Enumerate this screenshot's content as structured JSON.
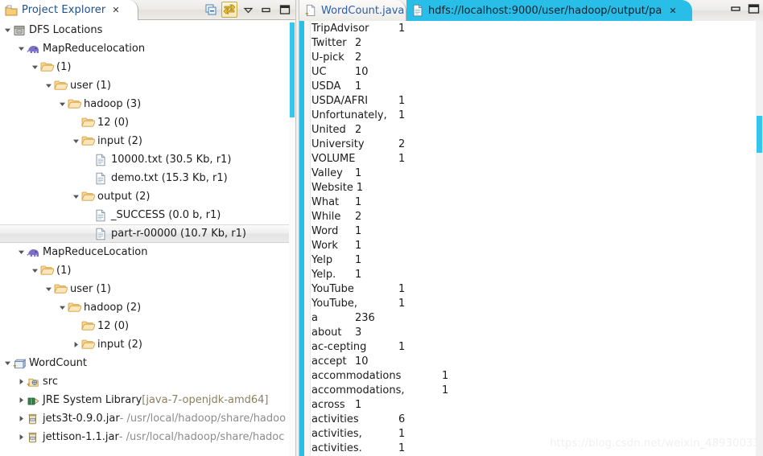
{
  "explorer": {
    "tab_title": "Project Explorer",
    "tab_close": "✕",
    "toolbar": [
      {
        "name": "collapse-all-icon",
        "title": "Collapse All"
      },
      {
        "name": "link-with-editor-icon",
        "title": "Link with Editor"
      },
      {
        "name": "view-menu-icon",
        "title": "View Menu"
      },
      {
        "name": "minimize-icon",
        "title": "Minimize"
      },
      {
        "name": "maximize-icon",
        "title": "Maximize"
      }
    ],
    "tree": [
      {
        "indent": 0,
        "twist": "down",
        "icon": "dfs-locations-icon",
        "label": "DFS Locations",
        "type": "root"
      },
      {
        "indent": 1,
        "twist": "down",
        "icon": "elephant-icon",
        "label": "MapReducelocation",
        "type": "location"
      },
      {
        "indent": 2,
        "twist": "down",
        "icon": "folder-icon",
        "label": "(1)",
        "type": "folder"
      },
      {
        "indent": 3,
        "twist": "down",
        "icon": "folder-icon",
        "label": "user (1)",
        "type": "folder"
      },
      {
        "indent": 4,
        "twist": "down",
        "icon": "folder-icon",
        "label": "hadoop (3)",
        "type": "folder"
      },
      {
        "indent": 5,
        "twist": "none",
        "icon": "folder-icon",
        "label": "12 (0)",
        "type": "folder"
      },
      {
        "indent": 5,
        "twist": "down",
        "icon": "folder-icon",
        "label": "input (2)",
        "type": "folder"
      },
      {
        "indent": 6,
        "twist": "none",
        "icon": "file-icon",
        "label": "10000.txt (30.5 Kb, r1)",
        "type": "file"
      },
      {
        "indent": 6,
        "twist": "none",
        "icon": "file-icon",
        "label": "demo.txt (15.3 Kb, r1)",
        "type": "file"
      },
      {
        "indent": 5,
        "twist": "down",
        "icon": "folder-icon",
        "label": "output (2)",
        "type": "folder"
      },
      {
        "indent": 6,
        "twist": "none",
        "icon": "file-icon",
        "label": "_SUCCESS (0.0 b, r1)",
        "type": "file"
      },
      {
        "indent": 6,
        "twist": "none",
        "icon": "file-icon",
        "label": "part-r-00000 (10.7 Kb, r1)",
        "type": "file",
        "selected": true
      },
      {
        "indent": 1,
        "twist": "down",
        "icon": "elephant-icon",
        "label": "MapReduceLocation",
        "type": "location"
      },
      {
        "indent": 2,
        "twist": "down",
        "icon": "folder-icon",
        "label": "(1)",
        "type": "folder"
      },
      {
        "indent": 3,
        "twist": "down",
        "icon": "folder-icon",
        "label": "user (1)",
        "type": "folder"
      },
      {
        "indent": 4,
        "twist": "down",
        "icon": "folder-icon",
        "label": "hadoop (2)",
        "type": "folder"
      },
      {
        "indent": 5,
        "twist": "none",
        "icon": "folder-icon",
        "label": "12 (0)",
        "type": "folder"
      },
      {
        "indent": 5,
        "twist": "right",
        "icon": "folder-icon",
        "label": "input (2)",
        "type": "folder"
      },
      {
        "indent": 0,
        "twist": "down",
        "icon": "java-project-icon",
        "label": "WordCount",
        "type": "project"
      },
      {
        "indent": 1,
        "twist": "right",
        "icon": "source-folder-icon",
        "label": "src",
        "type": "srcfolder"
      },
      {
        "indent": 1,
        "twist": "right",
        "icon": "library-icon",
        "label": "JRE System Library ",
        "suffix": "[java-7-openjdk-amd64]",
        "suffix_style": "dim",
        "type": "library"
      },
      {
        "indent": 1,
        "twist": "right",
        "icon": "jar-icon",
        "label": "jets3t-0.9.0.jar ",
        "suffix": "- /usr/local/hadoop/share/hadoo",
        "suffix_style": "path",
        "type": "jar"
      },
      {
        "indent": 1,
        "twist": "right",
        "icon": "jar-icon",
        "label": "jettison-1.1.jar ",
        "suffix": "- /usr/local/hadoop/share/hadoc",
        "suffix_style": "path",
        "type": "jar"
      }
    ]
  },
  "editor": {
    "tabs": [
      {
        "label": "WordCount.java",
        "icon": "java-file-icon",
        "active": false,
        "closable": false
      },
      {
        "label": "hdfs://localhost:9000/user/hadoop/output/pa",
        "icon": "text-file-icon",
        "active": true,
        "closable": true,
        "close": "✕"
      }
    ],
    "lines": [
      {
        "word": "TripAdvisor",
        "count": "1"
      },
      {
        "word": "Twitter",
        "count": "2"
      },
      {
        "word": "U-pick",
        "count": "2"
      },
      {
        "word": "UC",
        "count": "10"
      },
      {
        "word": "USDA",
        "count": "1"
      },
      {
        "word": "USDA/AFRI",
        "count": "1"
      },
      {
        "word": "Unfortunately,",
        "count": "1"
      },
      {
        "word": "United",
        "count": "2"
      },
      {
        "word": "University",
        "count": "2"
      },
      {
        "word": "VOLUME",
        "count": "1"
      },
      {
        "word": "Valley",
        "count": "1"
      },
      {
        "word": "Website",
        "count": "1"
      },
      {
        "word": "What",
        "count": "1"
      },
      {
        "word": "While",
        "count": "2"
      },
      {
        "word": "Word",
        "count": "1"
      },
      {
        "word": "Work",
        "count": "1"
      },
      {
        "word": "Yelp",
        "count": "1"
      },
      {
        "word": "Yelp.",
        "count": "1"
      },
      {
        "word": "YouTube",
        "count": "1"
      },
      {
        "word": "YouTube,",
        "count": "1"
      },
      {
        "word": "a",
        "count": "236"
      },
      {
        "word": "about",
        "count": "3"
      },
      {
        "word": "ac-cepting",
        "count": "1"
      },
      {
        "word": "accept",
        "count": "10"
      },
      {
        "word": "accommodations",
        "count": "1"
      },
      {
        "word": "accommodations,",
        "count": "1"
      },
      {
        "word": "across",
        "count": "1"
      },
      {
        "word": "activities",
        "count": "6"
      },
      {
        "word": "activities,",
        "count": "1"
      },
      {
        "word": "activities.",
        "count": "1"
      }
    ]
  },
  "window": {
    "minimize_title": "Minimize",
    "maximize_title": "Maximize"
  },
  "watermark": "https://blog.csdn.net/weixin_48930033",
  "colors": {
    "accent_cyan": "#28bee8",
    "scrollbar_cyan": "#35c6f0",
    "tab_link_blue": "#2a5ea8",
    "folder_orange": "#e8a33d"
  }
}
